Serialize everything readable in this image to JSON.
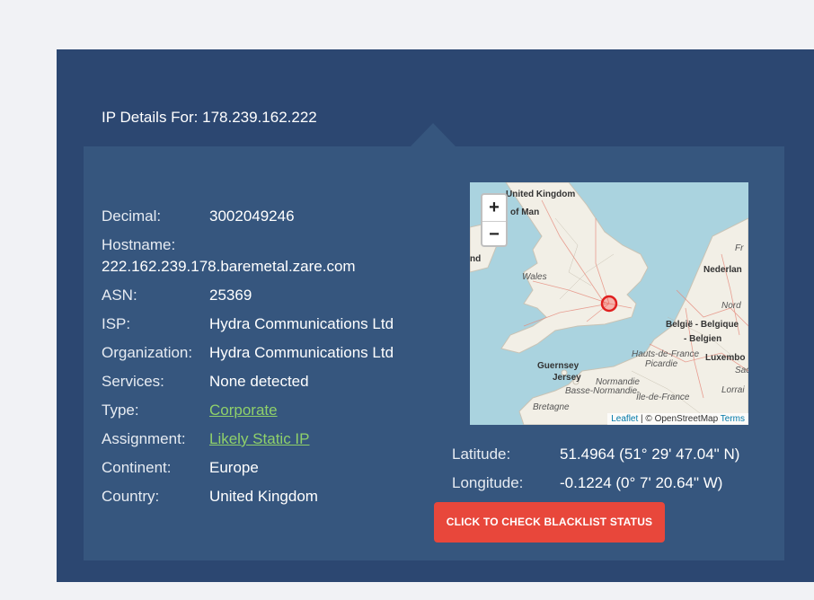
{
  "header": {
    "title": "IP Details For: 178.239.162.222"
  },
  "details": {
    "decimal_label": "Decimal:",
    "decimal_value": "3002049246",
    "hostname_label": "Hostname:",
    "hostname_value": "222.162.239.178.baremetal.zare.com",
    "asn_label": "ASN:",
    "asn_value": "25369",
    "isp_label": "ISP:",
    "isp_value": "Hydra Communications Ltd",
    "org_label": "Organization:",
    "org_value": "Hydra Communications Ltd",
    "services_label": "Services:",
    "services_value": "None detected",
    "type_label": "Type:",
    "type_value": "Corporate",
    "assignment_label": "Assignment:",
    "assignment_value": "Likely Static IP",
    "continent_label": "Continent:",
    "continent_value": "Europe",
    "country_label": "Country:",
    "country_value": "United Kingdom"
  },
  "map": {
    "zoom_in": "+",
    "zoom_out": "−",
    "attribution_leaflet": "Leaflet",
    "attribution_sep": " | © OpenStreetMap ",
    "attribution_terms": "Terms",
    "labels": {
      "united_kingdom": "United Kingdom",
      "isle_of_man": "of Man",
      "nd": "nd",
      "wales": "Wales",
      "nederland": "Nederlan",
      "fr": "Fr",
      "nord": "Nord",
      "belgie": "België - Belgique",
      "belgien": "- Belgien",
      "hauts": "Hauts-de-France",
      "picardie": "Picardie",
      "luxemb": "Luxembo",
      "sac": "Sac",
      "guernsey": "Guernsey",
      "jersey": "Jersey",
      "normandie": "Normandie",
      "basse": "Basse-Normandie",
      "ile": "Île-de-France",
      "lorrai": "Lorrai",
      "bretagne": "Bretagne"
    }
  },
  "coords": {
    "latitude_label": "Latitude:",
    "latitude_value": "51.4964  (51° 29' 47.04\" N)",
    "longitude_label": "Longitude:",
    "longitude_value": "-0.1224  (0° 7' 20.64\" W)"
  },
  "actions": {
    "blacklist_button": "CLICK TO CHECK BLACKLIST STATUS"
  },
  "colors": {
    "outer_bg": "#2c4771",
    "inner_bg": "#36567e",
    "link": "#8fd06a",
    "button": "#e8473b"
  }
}
